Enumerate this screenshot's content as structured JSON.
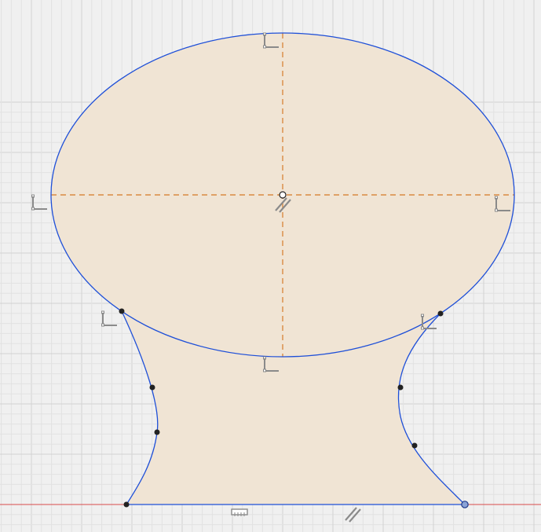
{
  "app": {
    "view": "sketch",
    "colors": {
      "background": "#f0f0f0",
      "grid_minor": "#e2e2e2",
      "grid_major": "#d2d2d2",
      "profile_fill": "#f0e4d4",
      "sketch_line": "#1e4fd8",
      "construction_line": "#d98a42",
      "point": "#222222",
      "origin_axis": "#d94b4b",
      "constraint_icon": "#8a8a8a"
    }
  },
  "sketch": {
    "entities": [
      {
        "id": "ellipse",
        "type": "ellipse",
        "role": "head"
      },
      {
        "id": "major-axis",
        "type": "construction-line",
        "orientation": "horizontal"
      },
      {
        "id": "minor-axis",
        "type": "construction-line",
        "orientation": "vertical"
      },
      {
        "id": "left-spline",
        "type": "spline",
        "fit_points": 4
      },
      {
        "id": "right-spline",
        "type": "spline",
        "fit_points": 4
      },
      {
        "id": "base-line",
        "type": "line",
        "orientation": "horizontal"
      }
    ],
    "constraints": [
      {
        "type": "perpendicular",
        "icon": "perpendicular-icon",
        "count": 6
      },
      {
        "type": "parallel",
        "icon": "parallel-icon",
        "count": 2
      },
      {
        "type": "horizontal",
        "icon": "horizontal-icon",
        "count": 1
      }
    ]
  }
}
